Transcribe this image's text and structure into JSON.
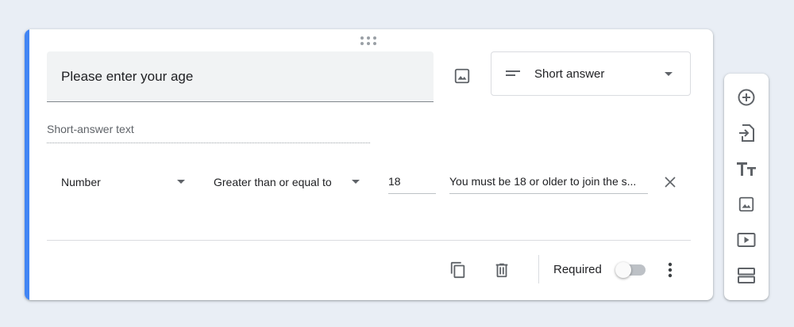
{
  "question": {
    "title": "Please enter your age",
    "type_label": "Short answer",
    "answer_placeholder": "Short-answer text"
  },
  "validation": {
    "type": "Number",
    "condition": "Greater than or equal to",
    "value": "18",
    "error_text": "You must be 18 or older to join the s..."
  },
  "footer": {
    "required_label": "Required",
    "required_on": false
  },
  "colors": {
    "accent": "#4285f4",
    "icon": "#5f6368"
  },
  "icons": {
    "drag": "drag-handle-icon",
    "image": "image-icon",
    "type": "short-text-icon",
    "close": "close-icon",
    "copy": "copy-icon",
    "delete": "trash-icon",
    "more": "more-vertical-icon",
    "toolbar": [
      "add-circle-icon",
      "import-icon",
      "title-icon",
      "image-icon",
      "video-icon",
      "section-icon"
    ]
  }
}
